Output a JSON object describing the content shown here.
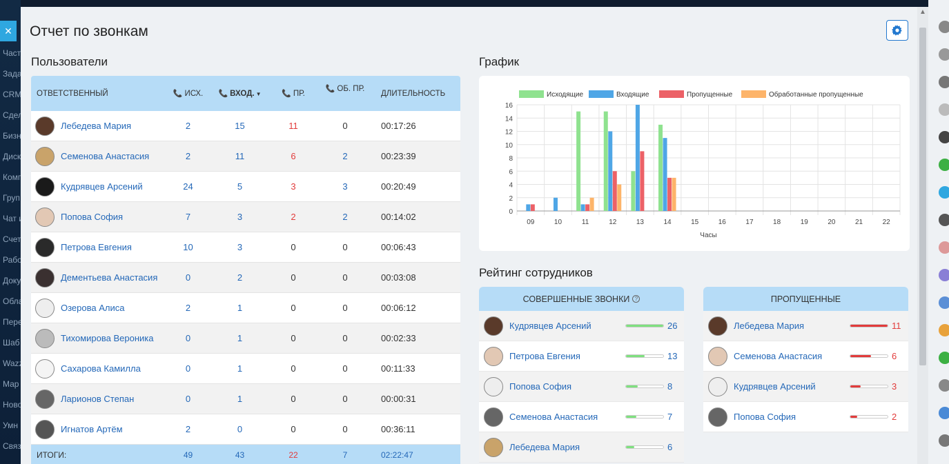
{
  "page": {
    "title": "Отчет по звонкам"
  },
  "sidebar_left": {
    "items": [
      "Част",
      "Зада",
      "CRM",
      "Сдел",
      "Бизн",
      "Диск",
      "Комп",
      "Груп",
      "Чат и",
      "Счет",
      "Рабо",
      "Доку",
      "Обла",
      "Пере",
      "Шаб",
      "Wazz",
      "Мар",
      "Ново",
      "Умн",
      "Связ"
    ]
  },
  "users": {
    "section_title": "Пользователи",
    "headers": {
      "responsible": "ОТВЕТСТВЕННЫЙ",
      "outgoing": "ИСХ.",
      "incoming": "ВХОД.",
      "missed": "ПР.",
      "processed": "ОБ. ПР.",
      "duration": "ДЛИТЕЛЬНОСТЬ"
    },
    "rows": [
      {
        "name": "Лебедева Мария",
        "out": "2",
        "in": "15",
        "missed": "11",
        "processed": "0",
        "duration": "00:17:26"
      },
      {
        "name": "Семенова Анастасия",
        "out": "2",
        "in": "11",
        "missed": "6",
        "processed": "2",
        "duration": "00:23:39"
      },
      {
        "name": "Кудрявцев Арсений",
        "out": "24",
        "in": "5",
        "missed": "3",
        "processed": "3",
        "duration": "00:20:49"
      },
      {
        "name": "Попова София",
        "out": "7",
        "in": "3",
        "missed": "2",
        "processed": "2",
        "duration": "00:14:02"
      },
      {
        "name": "Петрова Евгения",
        "out": "10",
        "in": "3",
        "missed": "0",
        "processed": "0",
        "duration": "00:06:43"
      },
      {
        "name": "Дементьева Анастасия",
        "out": "0",
        "in": "2",
        "missed": "0",
        "processed": "0",
        "duration": "00:03:08"
      },
      {
        "name": "Озерова Алиса",
        "out": "2",
        "in": "1",
        "missed": "0",
        "processed": "0",
        "duration": "00:06:12"
      },
      {
        "name": "Тихомирова Вероника",
        "out": "0",
        "in": "1",
        "missed": "0",
        "processed": "0",
        "duration": "00:02:33"
      },
      {
        "name": "Сахарова Камилла",
        "out": "0",
        "in": "1",
        "missed": "0",
        "processed": "0",
        "duration": "00:11:33"
      },
      {
        "name": "Ларионов Степан",
        "out": "0",
        "in": "1",
        "missed": "0",
        "processed": "0",
        "duration": "00:00:31"
      },
      {
        "name": "Игнатов Артём",
        "out": "2",
        "in": "0",
        "missed": "0",
        "processed": "0",
        "duration": "00:36:11"
      }
    ],
    "totals": {
      "label": "ИТОГИ:",
      "out": "49",
      "in": "43",
      "missed": "22",
      "processed": "7",
      "duration": "02:22:47"
    }
  },
  "chart_section": {
    "title": "График"
  },
  "chart_data": {
    "type": "bar",
    "title": "",
    "xlabel": "Часы",
    "ylabel": "",
    "ylim": [
      0,
      16
    ],
    "yticks": [
      0,
      2,
      4,
      6,
      8,
      10,
      12,
      14,
      16
    ],
    "grid": true,
    "legend_position": "top",
    "categories": [
      "09",
      "10",
      "11",
      "12",
      "13",
      "14",
      "15",
      "16",
      "17",
      "18",
      "19",
      "20",
      "21",
      "22"
    ],
    "series": [
      {
        "name": "Исходящие",
        "color": "#8fe28f",
        "values": [
          0,
          0,
          15,
          15,
          6,
          13,
          0,
          0,
          0,
          0,
          0,
          0,
          0,
          0
        ]
      },
      {
        "name": "Входящие",
        "color": "#4fa6e6",
        "values": [
          1,
          2,
          1,
          12,
          16,
          11,
          0,
          0,
          0,
          0,
          0,
          0,
          0,
          0
        ]
      },
      {
        "name": "Пропущенные",
        "color": "#ec6167",
        "values": [
          1,
          0,
          1,
          6,
          9,
          5,
          0,
          0,
          0,
          0,
          0,
          0,
          0,
          0
        ]
      },
      {
        "name": "Обработанные пропущенные",
        "color": "#fdb46a",
        "values": [
          0,
          0,
          2,
          4,
          0,
          5,
          0,
          0,
          0,
          0,
          0,
          0,
          0,
          0
        ]
      }
    ]
  },
  "rating": {
    "title": "Рейтинг сотрудников",
    "completed": {
      "header": "СОВЕРШЕННЫЕ ЗВОНКИ",
      "help_glyph": "?",
      "bar_color": "#7fe07f",
      "rows": [
        {
          "name": "Кудрявцев Арсений",
          "value": "26",
          "fill": 1.0
        },
        {
          "name": "Петрова Евгения",
          "value": "13",
          "fill": 0.5
        },
        {
          "name": "Попова София",
          "value": "8",
          "fill": 0.31
        },
        {
          "name": "Семенова Анастасия",
          "value": "7",
          "fill": 0.27
        },
        {
          "name": "Лебедева Мария",
          "value": "6",
          "fill": 0.23
        }
      ]
    },
    "missed": {
      "header": "ПРОПУЩЕННЫЕ",
      "bar_color": "#e23b3b",
      "rows": [
        {
          "name": "Лебедева Мария",
          "value": "11",
          "fill": 1.0
        },
        {
          "name": "Семенова Анастасия",
          "value": "6",
          "fill": 0.55
        },
        {
          "name": "Кудрявцев Арсений",
          "value": "3",
          "fill": 0.27
        },
        {
          "name": "Попова София",
          "value": "2",
          "fill": 0.18
        }
      ]
    }
  },
  "colors": {
    "accent": "#2278cf",
    "header_bg": "#b6dcf7",
    "link": "#2468b8",
    "missed_red": "#e23b3b"
  }
}
